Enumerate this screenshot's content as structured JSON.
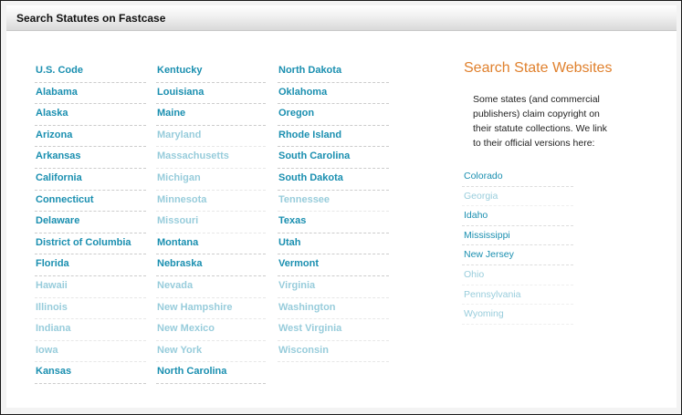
{
  "header": {
    "title": "Search Statutes on Fastcase"
  },
  "columns": [
    [
      {
        "label": "U.S. Code",
        "faded": false
      },
      {
        "label": "Alabama",
        "faded": false
      },
      {
        "label": "Alaska",
        "faded": false
      },
      {
        "label": "Arizona",
        "faded": false
      },
      {
        "label": "Arkansas",
        "faded": false
      },
      {
        "label": "California",
        "faded": false
      },
      {
        "label": "Connecticut",
        "faded": false
      },
      {
        "label": "Delaware",
        "faded": false
      },
      {
        "label": "District of Columbia",
        "faded": false
      },
      {
        "label": "Florida",
        "faded": false
      },
      {
        "label": "Hawaii",
        "faded": true
      },
      {
        "label": "Illinois",
        "faded": true
      },
      {
        "label": "Indiana",
        "faded": true
      },
      {
        "label": "Iowa",
        "faded": true
      },
      {
        "label": "Kansas",
        "faded": false
      }
    ],
    [
      {
        "label": "Kentucky",
        "faded": false
      },
      {
        "label": "Louisiana",
        "faded": false
      },
      {
        "label": "Maine",
        "faded": false
      },
      {
        "label": "Maryland",
        "faded": true
      },
      {
        "label": "Massachusetts",
        "faded": true
      },
      {
        "label": "Michigan",
        "faded": true
      },
      {
        "label": "Minnesota",
        "faded": true
      },
      {
        "label": "Missouri",
        "faded": true
      },
      {
        "label": "Montana",
        "faded": false
      },
      {
        "label": "Nebraska",
        "faded": false
      },
      {
        "label": "Nevada",
        "faded": true
      },
      {
        "label": "New Hampshire",
        "faded": true
      },
      {
        "label": "New Mexico",
        "faded": true
      },
      {
        "label": "New York",
        "faded": true
      },
      {
        "label": "North Carolina",
        "faded": false
      }
    ],
    [
      {
        "label": "North Dakota",
        "faded": false
      },
      {
        "label": "Oklahoma",
        "faded": false
      },
      {
        "label": "Oregon",
        "faded": false
      },
      {
        "label": "Rhode Island",
        "faded": false
      },
      {
        "label": "South Carolina",
        "faded": false
      },
      {
        "label": "South Dakota",
        "faded": false
      },
      {
        "label": "Tennessee",
        "faded": true
      },
      {
        "label": "Texas",
        "faded": false
      },
      {
        "label": "Utah",
        "faded": false
      },
      {
        "label": "Vermont",
        "faded": false
      },
      {
        "label": "Virginia",
        "faded": true
      },
      {
        "label": "Washington",
        "faded": true
      },
      {
        "label": "West Virginia",
        "faded": true
      },
      {
        "label": "Wisconsin",
        "faded": true
      }
    ]
  ],
  "sidebar": {
    "title": "Search State Websites",
    "description": "Some states (and commercial publishers) claim copyright on their statute collections. We link to their official versions here:",
    "states": [
      {
        "label": "Colorado",
        "faded": false
      },
      {
        "label": "Georgia",
        "faded": true
      },
      {
        "label": "Idaho",
        "faded": false
      },
      {
        "label": "Mississippi",
        "faded": false
      },
      {
        "label": "New Jersey",
        "faded": false
      },
      {
        "label": "Ohio",
        "faded": true
      },
      {
        "label": "Pennsylvania",
        "faded": true
      },
      {
        "label": "Wyoming",
        "faded": true
      }
    ]
  },
  "colors": {
    "link": "#1a8fb0",
    "link_faded": "#1a8fb0",
    "sidebar_title": "#e0812e"
  }
}
